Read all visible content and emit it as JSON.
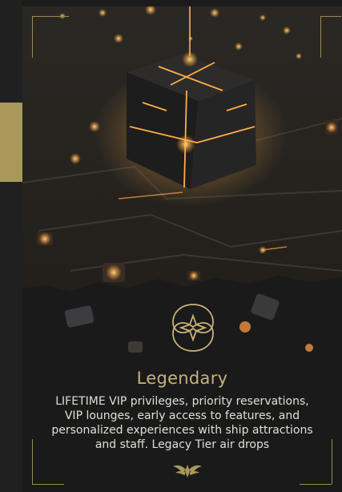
{
  "card": {
    "title": "Legendary",
    "description": "LIFETIME VIP privileges, priority reservations, VIP lounges, early access to features, and personalized experiences with ship attractions and staff. Legacy Tier air drops"
  },
  "colors": {
    "gold": "#c8b27a",
    "accent_tab": "#a8995a",
    "text": "#e2ded6",
    "background": "#1a1a1a"
  },
  "icons": {
    "emblem": "ornamental-star-emblem-icon",
    "footer": "winged-crest-icon"
  }
}
